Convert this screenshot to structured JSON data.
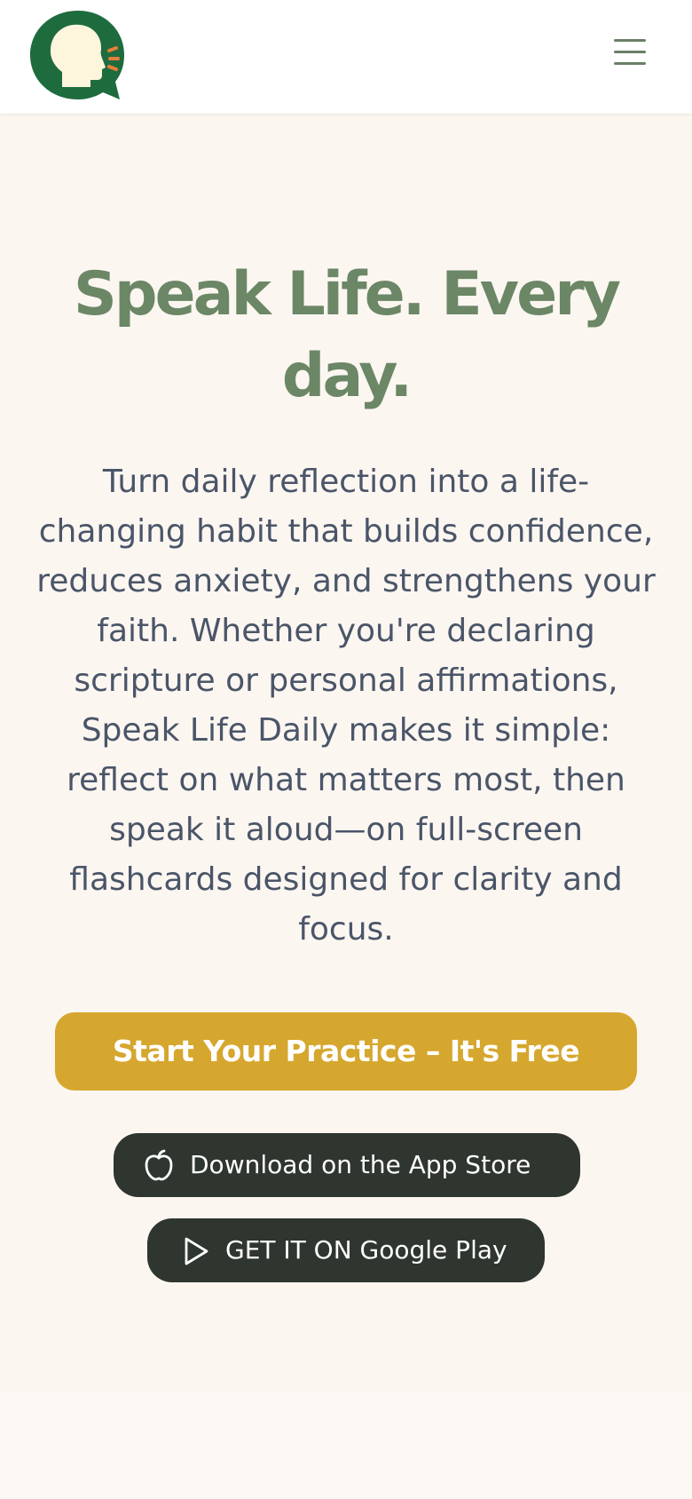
{
  "header": {
    "logo_icon": "speaking-head-bubble-icon",
    "menu_icon": "hamburger-menu-icon",
    "colors": {
      "logo_green": "#1e6b3e",
      "logo_face": "#fdf5dc",
      "logo_sound": "#e67e3a",
      "menu": "#6b7f66"
    }
  },
  "hero": {
    "headline": "Speak Life. Every day.",
    "description": "Turn daily reflection into a life-changing habit that builds confidence, reduces anxiety, and strengthens your faith. Whether you're declaring scripture or personal affirmations, Speak Life Daily makes it simple: reflect on what matters most, then speak it aloud—on full-screen flashcards designed for clarity and focus.",
    "cta_label": "Start Your Practice – It's Free",
    "app_store_label": "Download on the App Store",
    "app_store_icon": "apple-icon",
    "google_play_label": "GET IT ON Google Play",
    "google_play_icon": "play-icon",
    "colors": {
      "headline": "#6b8766",
      "body_text": "#4a5568",
      "cta_background": "#d6a72e",
      "store_button_background": "#2f352f",
      "page_background": "#fcf6f1"
    }
  }
}
